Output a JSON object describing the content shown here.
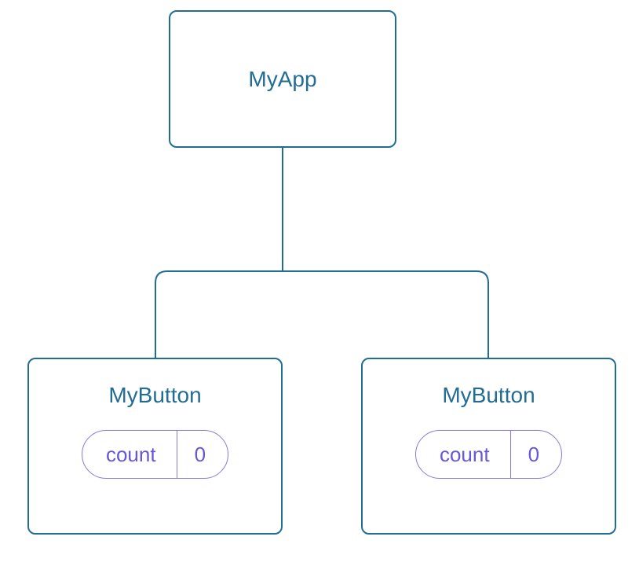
{
  "diagram": {
    "parent": {
      "title": "MyApp"
    },
    "children": [
      {
        "title": "MyButton",
        "state": {
          "label": "count",
          "value": "0"
        }
      },
      {
        "title": "MyButton",
        "state": {
          "label": "count",
          "value": "0"
        }
      }
    ]
  }
}
